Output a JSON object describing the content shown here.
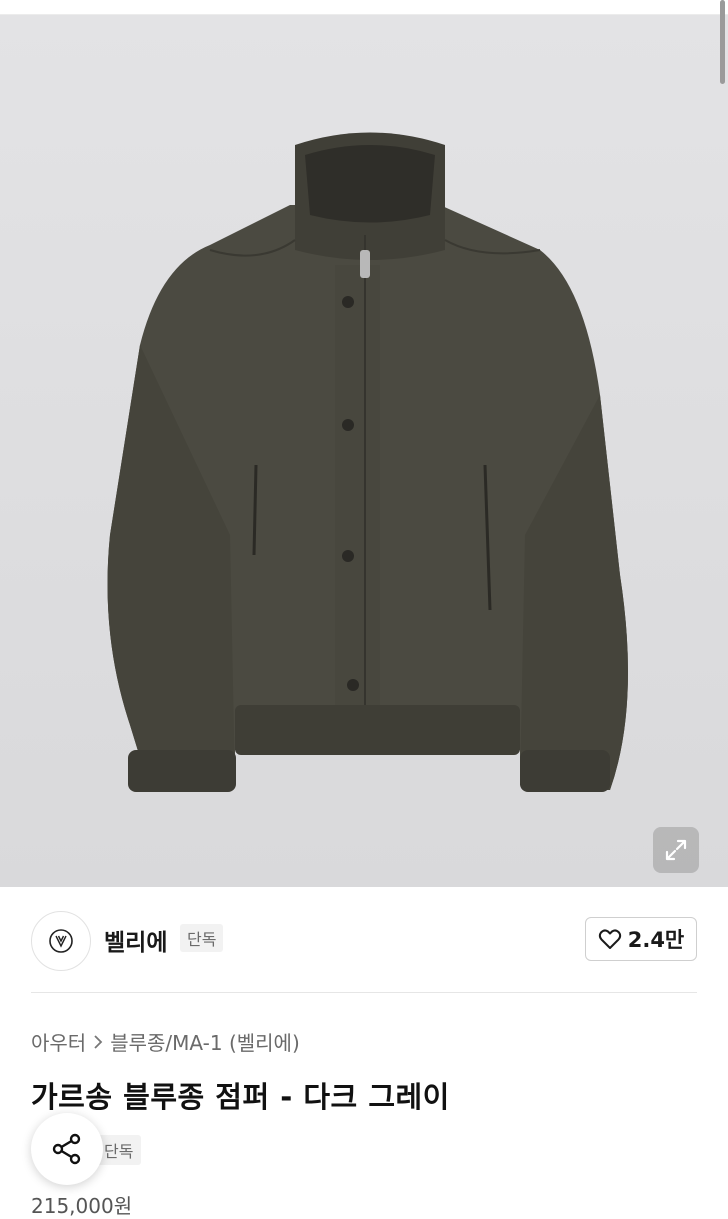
{
  "hero": {
    "image_alt": "jacket-photo"
  },
  "brand": {
    "name": "벨리에",
    "badge": "단독"
  },
  "like": {
    "count": "2.4만"
  },
  "breadcrumb": {
    "items": [
      "아우터",
      "블루종/MA-1 (벨리에)"
    ]
  },
  "product": {
    "title": "가르송 블루종 점퍼 - 다크 그레이",
    "badge": "단독",
    "price": "215,000원"
  },
  "icons": {
    "expand": "expand-icon",
    "heart": "heart-icon",
    "share": "share-icon",
    "chevron": "chevron-right-icon"
  },
  "colors": {
    "jacket": "#4a4a40",
    "background": "#e0e0e2"
  }
}
